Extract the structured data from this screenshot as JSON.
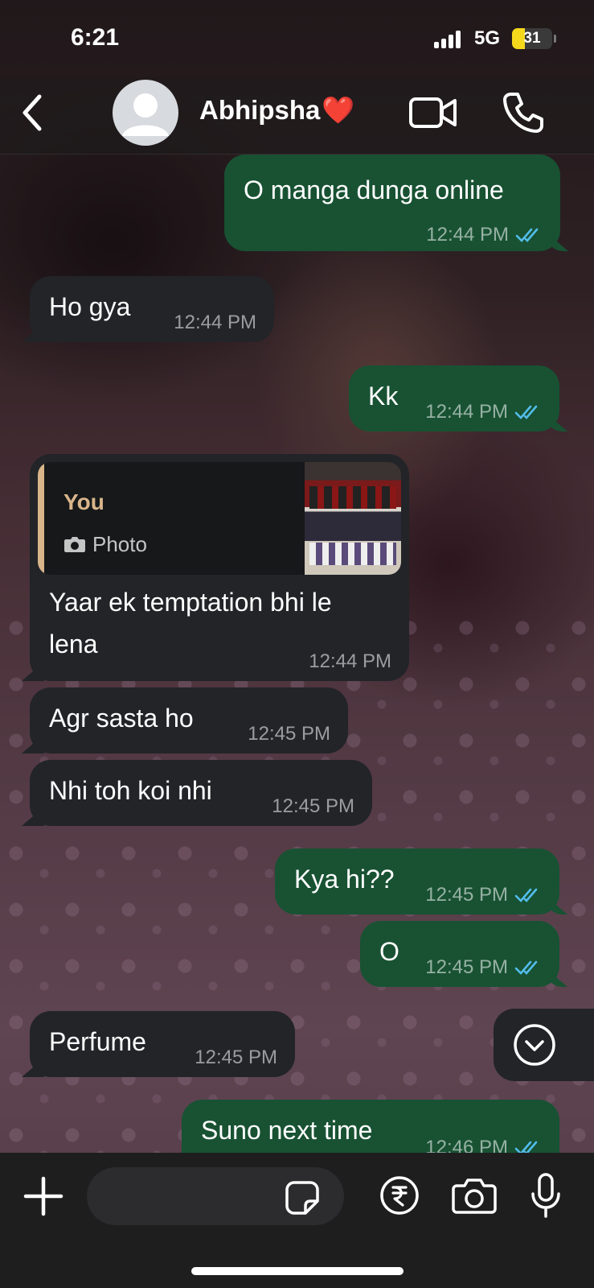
{
  "status_bar": {
    "time": "6:21",
    "network": "5G",
    "battery": "31",
    "battery_level_percent": 31,
    "battery_color": "#f4d81c"
  },
  "header": {
    "contact_name": "Abhipsha",
    "contact_emoji": "❤️",
    "back_icon": "chevron-left-icon",
    "video_icon": "video-camera-icon",
    "call_icon": "phone-icon"
  },
  "colors": {
    "outgoing_bubble": "#185233",
    "incoming_bubble": "#222428",
    "read_ticks": "#53bdeb",
    "quote_accent": "#d9b58a"
  },
  "messages": [
    {
      "direction": "out",
      "text": "O manga dunga online",
      "time": "12:44 PM",
      "status": "read"
    },
    {
      "direction": "in",
      "text": "Ho gya",
      "time": "12:44 PM"
    },
    {
      "direction": "out",
      "text": "Kk",
      "time": "12:44 PM",
      "status": "read"
    },
    {
      "direction": "in",
      "text_line1": "Yaar ek temptation bhi le",
      "text_line2": "lena",
      "time": "12:44 PM",
      "quote": {
        "sender": "You",
        "type": "Photo",
        "type_icon": "camera-icon"
      }
    },
    {
      "direction": "in",
      "text": "Agr sasta ho",
      "time": "12:45 PM"
    },
    {
      "direction": "in",
      "text": "Nhi toh koi nhi",
      "time": "12:45 PM"
    },
    {
      "direction": "out",
      "text": "Kya hi??",
      "time": "12:45 PM",
      "status": "read"
    },
    {
      "direction": "out",
      "text": "O",
      "time": "12:45 PM",
      "status": "read"
    },
    {
      "direction": "in",
      "text": "Perfume",
      "time": "12:45 PM"
    },
    {
      "direction": "out",
      "text": "Suno next time",
      "time": "12:46 PM",
      "status": "read"
    }
  ],
  "input_bar": {
    "plus_icon": "plus-icon",
    "sticker_icon": "sticker-icon",
    "payment_icon": "rupee-icon",
    "camera_icon": "camera-icon",
    "mic_icon": "microphone-icon"
  }
}
